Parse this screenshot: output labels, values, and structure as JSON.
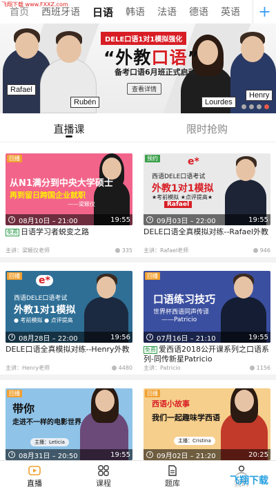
{
  "watermark_top": "飞翔下载 www.FXXZ.com",
  "watermark_bottom": "飞翔下载",
  "lang_tabs": [
    {
      "label": "首页"
    },
    {
      "label": "西班牙语"
    },
    {
      "label": "日语"
    },
    {
      "label": "韩语"
    },
    {
      "label": "法语"
    },
    {
      "label": "德语"
    },
    {
      "label": "英语"
    }
  ],
  "active_lang": "日语",
  "add_label": "+",
  "banner": {
    "tag": "DELE口语1对1模拟强化",
    "title_a": "“外教",
    "title_b": "口语",
    "title_c": "”",
    "subtitle": "备考口语6月班正式启动",
    "button": "查看详情",
    "teachers": [
      "Rafael",
      "Rubén",
      "Lourdes",
      "Henry"
    ]
  },
  "section_tabs": [
    {
      "label": "直播课"
    },
    {
      "label": "限时抢购"
    }
  ],
  "courses": [
    {
      "badge": "回播",
      "badge_color": "#f0a030",
      "thumb_line1": "从N1满分到中央大学硕士",
      "thumb_line2": "再到留日跨国企业就职",
      "thumb_line3": "——梁颖仪",
      "thumb_bg": "#f2648a",
      "time": "08月10日 – 21:00",
      "duration": "19:55",
      "free": "",
      "title": "日语学习者蜕变之路",
      "teacher": "主讲：梁颖仪老师",
      "views": "335"
    },
    {
      "badge": "预约",
      "badge_color": "#3aa04a",
      "thumb_line1": "西语DELE口语考试",
      "thumb_line2": "外教1对1模拟",
      "thumb_line3": "★考前模拟 ★点评提高★",
      "thumb_name": "Rafael",
      "thumb_bg": "#e9e9e9",
      "time": "09月03日 – 22:00",
      "duration": "19:55",
      "free": "",
      "title": "DELE口语全真模拟对练--Rafael外教",
      "teacher": "主讲：Rafael老师",
      "views": "946"
    },
    {
      "badge": "回播",
      "badge_color": "#f0a030",
      "thumb_line1": "西语DELE口语考试",
      "thumb_line2": "外教1对1模拟",
      "thumb_line3": "● 考前模拟  ● 点评提高",
      "thumb_bg": "#2f6f96",
      "time": "08月28日 – 22:00",
      "duration": "19:56",
      "free": "",
      "title": "DELE口语全真模拟对练--Henry外教",
      "teacher": "主讲：Henry老师",
      "views": "4480"
    },
    {
      "badge": "回播",
      "badge_color": "#f0a030",
      "thumb_line1": "口语练习技巧",
      "thumb_line2": "世界杯西语同声传译",
      "thumb_line3": "——Patricio",
      "thumb_bg": "#3b4fa0",
      "time": "07月16日 – 21:10",
      "duration": "19:55",
      "free": "免费",
      "title": "爱西语2018公开课系列之口语系列-同传新星Patricio",
      "teacher": "主讲：Patricio",
      "views": "1156"
    },
    {
      "badge": "回播",
      "badge_color": "#f0a030",
      "thumb_line1": "带你",
      "thumb_line2": "走进不一样的电影世界",
      "thumb_line3": "主播：Leticia",
      "thumb_bg": "#8fc3e8",
      "time": "08月31日 – 20:50",
      "duration": "19:55",
      "free": "",
      "title": "",
      "teacher": "",
      "views": ""
    },
    {
      "badge": "回播",
      "badge_color": "#f0a030",
      "thumb_line1": "西语小故事",
      "thumb_line2": "我们一起趣味学西语",
      "thumb_line3": "主播：Cristina",
      "thumb_bg": "#f6cf8c",
      "time": "09月02日 – 21:20",
      "duration": "20:25",
      "free": "",
      "title": "",
      "teacher": "",
      "views": ""
    }
  ],
  "bottom_nav": [
    {
      "label": "直播",
      "icon": "live-icon"
    },
    {
      "label": "课程",
      "icon": "grid-icon"
    },
    {
      "label": "题库",
      "icon": "document-icon"
    },
    {
      "label": "我的",
      "icon": "user-icon"
    }
  ],
  "colors": {
    "accent_blue": "#3a9df2",
    "brand_red": "#d81e25"
  }
}
